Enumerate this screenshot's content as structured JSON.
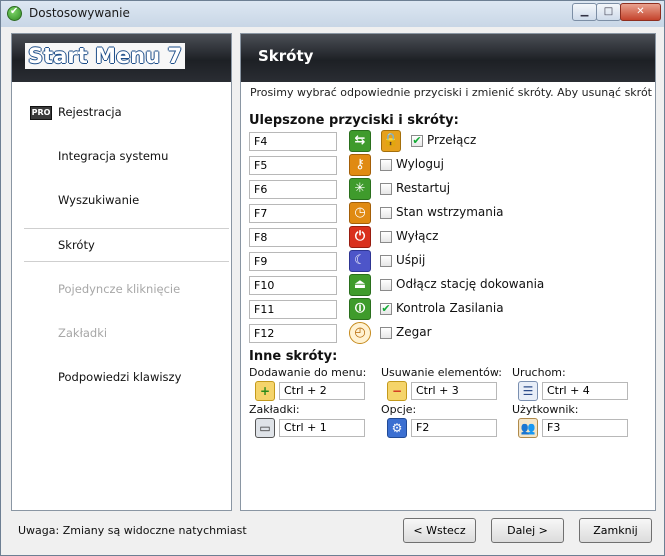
{
  "window": {
    "title": "Dostosowywanie"
  },
  "left": {
    "header": "Start Menu 7",
    "pro_badge": "PRO",
    "items": [
      {
        "label": "Rejestracja",
        "state": "normal"
      },
      {
        "label": "Integracja systemu",
        "state": "normal"
      },
      {
        "label": "Wyszukiwanie",
        "state": "normal"
      },
      {
        "label": "Skróty",
        "state": "selected"
      },
      {
        "label": "Pojedyncze kliknięcie",
        "state": "disabled"
      },
      {
        "label": "Zakładki",
        "state": "disabled"
      },
      {
        "label": "Podpowiedzi klawiszy",
        "state": "normal"
      }
    ]
  },
  "right": {
    "title": "Skróty",
    "description": "Prosimy wybrać odpowiednie przyciski i zmienić skróty. Aby usunąć skrót",
    "enhanced_heading": "Ulepszone przyciski i skróty:",
    "rows": [
      {
        "key": "F4",
        "label": "Przełącz",
        "checked": true,
        "icon": "switch-icon",
        "color": "#3f9b2c"
      },
      {
        "key": "F5",
        "label": "Wyloguj",
        "checked": false,
        "icon": "key-icon",
        "color": "#e08a12"
      },
      {
        "key": "F6",
        "label": "Restartuj",
        "checked": false,
        "icon": "restart-icon",
        "color": "#3f9b2c"
      },
      {
        "key": "F7",
        "label": "Stan wstrzymania",
        "checked": false,
        "icon": "standby-icon",
        "color": "#e08a12"
      },
      {
        "key": "F8",
        "label": "Wyłącz",
        "checked": false,
        "icon": "power-icon",
        "color": "#d9301d"
      },
      {
        "key": "F9",
        "label": "Uśpij",
        "checked": false,
        "icon": "sleep-icon",
        "color": "#4d55c9"
      },
      {
        "key": "F10",
        "label": "Odłącz stację dokowania",
        "checked": false,
        "icon": "undock-icon",
        "color": "#3f9b2c"
      },
      {
        "key": "F11",
        "label": "Kontrola Zasilania",
        "checked": true,
        "icon": "power-control-icon",
        "color": "#3f9b2c"
      },
      {
        "key": "F12",
        "label": "Zegar",
        "checked": false,
        "icon": "clock-icon",
        "color": "#e0a030"
      }
    ],
    "lock_icon": "lock-icon",
    "other_heading": "Inne skróty:",
    "other": [
      {
        "label": "Dodawanie do menu:",
        "value": "Ctrl + 2",
        "icon": "add-to-menu-icon"
      },
      {
        "label": "Usuwanie elementów:",
        "value": "Ctrl + 3",
        "icon": "remove-items-icon"
      },
      {
        "label": "Uruchom:",
        "value": "Ctrl + 4",
        "icon": "run-icon"
      },
      {
        "label": "Zakładki:",
        "value": "Ctrl + 1",
        "icon": "tabs-icon"
      },
      {
        "label": "Opcje:",
        "value": "F2",
        "icon": "options-icon"
      },
      {
        "label": "Użytkownik:",
        "value": "F3",
        "icon": "users-icon"
      }
    ]
  },
  "footer": {
    "note": "Uwaga: Zmiany są widoczne natychmiast",
    "back": "< Wstecz",
    "next": "Dalej >",
    "close": "Zamknij"
  }
}
